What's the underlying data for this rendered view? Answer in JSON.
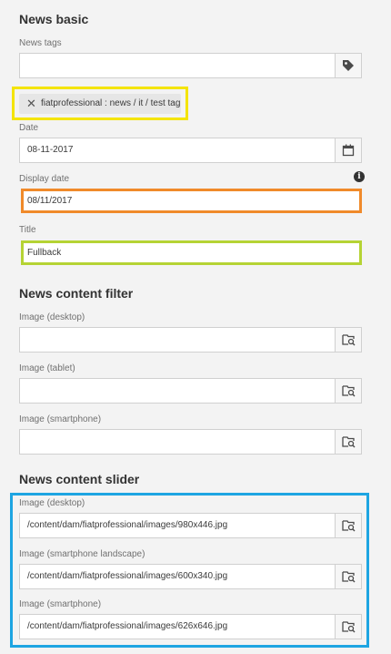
{
  "news_basic": {
    "title": "News basic",
    "news_tags_label": "News tags",
    "news_tags_value": "",
    "tag_chip": "fiatprofessional : news / it / test tag",
    "date_label": "Date",
    "date_value": "08-11-2017",
    "display_date_label": "Display date",
    "display_date_value": "08/11/2017",
    "title_label": "Title",
    "title_value": "Fullback"
  },
  "news_content_filter": {
    "title": "News content filter",
    "image_desktop_label": "Image (desktop)",
    "image_desktop_value": "",
    "image_tablet_label": "Image (tablet)",
    "image_tablet_value": "",
    "image_smartphone_label": "Image (smartphone)",
    "image_smartphone_value": ""
  },
  "news_content_slider": {
    "title": "News content slider",
    "image_desktop_label": "Image (desktop)",
    "image_desktop_value": "/content/dam/fiatprofessional/images/980x446.jpg",
    "image_smartphone_landscape_label": "Image (smartphone landscape)",
    "image_smartphone_landscape_value": "/content/dam/fiatprofessional/images/600x340.jpg",
    "image_smartphone_label": "Image (smartphone)",
    "image_smartphone_value": "/content/dam/fiatprofessional/images/626x646.jpg"
  },
  "highlight_colors": {
    "yellow": "#f4e400",
    "orange": "#f08a2a",
    "green": "#b5d334",
    "blue": "#1ea5e2"
  },
  "icons": [
    "tag-icon",
    "close-icon",
    "calendar-icon",
    "info-icon",
    "browse-asset-icon"
  ]
}
